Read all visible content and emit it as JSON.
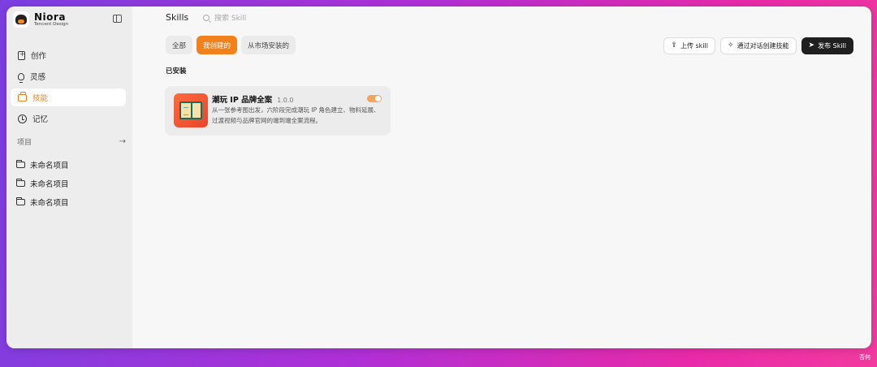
{
  "brand": {
    "name": "Niora",
    "subtitle": "Tencent Design"
  },
  "sidebar": {
    "nav": [
      {
        "label": "创作",
        "icon": "new-doc-icon",
        "active": false
      },
      {
        "label": "灵感",
        "icon": "bulb-icon",
        "active": false
      },
      {
        "label": "技能",
        "icon": "toolbox-icon",
        "active": true
      },
      {
        "label": "记忆",
        "icon": "clock-icon",
        "active": false
      }
    ],
    "projects_label": "项目",
    "projects": [
      "未命名项目",
      "未命名项目",
      "未命名项目"
    ]
  },
  "header": {
    "title": "Skills",
    "search_placeholder": "搜索 Skill"
  },
  "tabs": [
    {
      "label": "全部",
      "active": false
    },
    {
      "label": "我创建的",
      "active": true
    },
    {
      "label": "从市场安装的",
      "active": false
    }
  ],
  "actions": {
    "upload": "上传 skill",
    "create_by_chat": "通过对话创建技能",
    "publish": "发布 Skill"
  },
  "section": {
    "installed": "已安装"
  },
  "skills": [
    {
      "name": "潮玩 IP 品牌全案",
      "version": "1.0.0",
      "description": "从一张参考图出发，六阶段完成潮玩 IP 角色建立、物料延展、过渡视频与品牌官网的端到端全案流程。",
      "enabled": true
    }
  ],
  "colors": {
    "accent": "#f0811c",
    "dark_button": "#1f1f1f"
  },
  "watermark": "否何"
}
